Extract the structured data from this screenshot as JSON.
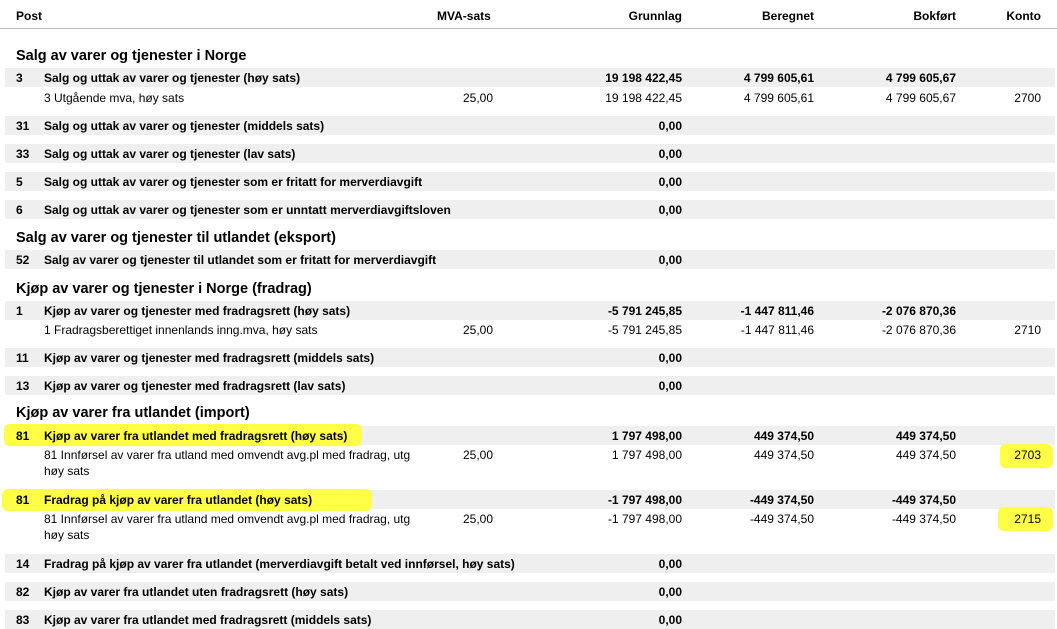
{
  "headers": {
    "post": "Post",
    "mva_sats": "MVA-sats",
    "grunnlag": "Grunnlag",
    "beregnet": "Beregnet",
    "bokfort": "Bokført",
    "konto": "Konto"
  },
  "sections": {
    "s1": "Salg av varer og tjenester i Norge",
    "s2": "Salg av varer og tjenester til utlandet (eksport)",
    "s3": "Kjøp av varer og tjenester i Norge (fradrag)",
    "s4": "Kjøp av varer fra utlandet (import)"
  },
  "rows": {
    "r3": {
      "post": "3",
      "desc": "Salg og uttak av varer og tjenester (høy sats)",
      "grunnlag": "19 198 422,45",
      "beregnet": "4 799 605,61",
      "bokfort": "4 799 605,67"
    },
    "r3d": {
      "desc": "3 Utgående mva, høy sats",
      "sats": "25,00",
      "grunnlag": "19 198 422,45",
      "beregnet": "4 799 605,61",
      "bokfort": "4 799 605,67",
      "konto": "2700"
    },
    "r31": {
      "post": "31",
      "desc": "Salg og uttak av varer og tjenester (middels sats)",
      "grunnlag": "0,00"
    },
    "r33": {
      "post": "33",
      "desc": "Salg og uttak av varer og tjenester (lav sats)",
      "grunnlag": "0,00"
    },
    "r5": {
      "post": "5",
      "desc": "Salg og uttak av varer og tjenester som er fritatt for merverdiavgift",
      "grunnlag": "0,00"
    },
    "r6": {
      "post": "6",
      "desc": "Salg og uttak av varer og tjenester som er unntatt merverdiavgiftsloven",
      "grunnlag": "0,00"
    },
    "r52": {
      "post": "52",
      "desc": "Salg av varer og tjenester til utlandet som er fritatt for merverdiavgift",
      "grunnlag": "0,00"
    },
    "r1": {
      "post": "1",
      "desc": "Kjøp av varer og tjenester med fradragsrett (høy sats)",
      "grunnlag": "-5 791 245,85",
      "beregnet": "-1 447 811,46",
      "bokfort": "-2 076 870,36"
    },
    "r1d": {
      "desc": "1 Fradragsberettiget innenlands inng.mva, høy sats",
      "sats": "25,00",
      "grunnlag": "-5 791 245,85",
      "beregnet": "-1 447 811,46",
      "bokfort": "-2 076 870,36",
      "konto": "2710"
    },
    "r11": {
      "post": "11",
      "desc": "Kjøp av varer og tjenester med fradragsrett (middels sats)",
      "grunnlag": "0,00"
    },
    "r13": {
      "post": "13",
      "desc": "Kjøp av varer og tjenester med fradragsrett (lav sats)",
      "grunnlag": "0,00"
    },
    "r81a": {
      "post": "81",
      "desc": "Kjøp av varer fra utlandet med fradragsrett (høy sats)",
      "grunnlag": "1 797 498,00",
      "beregnet": "449 374,50",
      "bokfort": "449 374,50"
    },
    "r81ad": {
      "desc": "81 Innførsel av varer fra utland med omvendt avg.pl med fradrag, utg høy sats",
      "sats": "25,00",
      "grunnlag": "1 797 498,00",
      "beregnet": "449 374,50",
      "bokfort": "449 374,50",
      "konto": "2703"
    },
    "r81b": {
      "post": "81",
      "desc": "Fradrag på kjøp av varer fra utlandet (høy sats)",
      "grunnlag": "-1 797 498,00",
      "beregnet": "-449 374,50",
      "bokfort": "-449 374,50"
    },
    "r81bd": {
      "desc": "81 Innførsel av varer fra utland med omvendt avg.pl med fradrag, utg høy sats",
      "sats": "25,00",
      "grunnlag": "-1 797 498,00",
      "beregnet": "-449 374,50",
      "bokfort": "-449 374,50",
      "konto": "2715"
    },
    "r14": {
      "post": "14",
      "desc": "Fradrag på kjøp av varer fra utlandet (merverdiavgift betalt ved innførsel, høy sats)",
      "grunnlag": "0,00"
    },
    "r82": {
      "post": "82",
      "desc": "Kjøp av varer fra utlandet uten fradragsrett (høy sats)",
      "grunnlag": "0,00"
    },
    "r83": {
      "post": "83",
      "desc": "Kjøp av varer fra utlandet med fradragsrett (middels sats)",
      "grunnlag": "0,00"
    }
  },
  "highlight_color": "#ffff3c"
}
